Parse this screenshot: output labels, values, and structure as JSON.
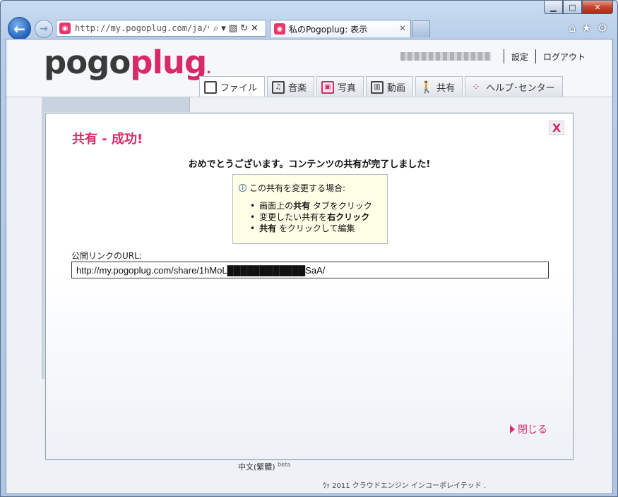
{
  "browser": {
    "address": "http://my.pogoplug.com/ja/view",
    "tab_title": "私のPogoplug: 表示"
  },
  "site": {
    "logo_a": "pogo",
    "logo_b": "plug",
    "settings": "設定",
    "logout": "ログアウト",
    "tabs": [
      {
        "label": "ファイル"
      },
      {
        "label": "音楽"
      },
      {
        "label": "写真"
      },
      {
        "label": "動画"
      },
      {
        "label": "共有"
      },
      {
        "label": "ヘルプ･センター"
      }
    ],
    "footer_lang": "中文(繁體)",
    "footer_beta": "beta",
    "footer_copy": "ｳｯ 2011 クラウドエンジン インコーポレイテッド ."
  },
  "modal": {
    "close_x": "X",
    "title": "共有 - 成功!",
    "message": "おめでとうございます。コンテンツの共有が完了しました!",
    "tip_heading": "この共有を変更する場合:",
    "tips": {
      "t1_a": "画面上の",
      "t1_b": "共有",
      "t1_c": " タブをクリック",
      "t2_a": "変更したい共有を",
      "t2_b": "右クリック",
      "t3_a": "共有",
      "t3_b": " をクリックして編集"
    },
    "url_label": "公開リンクのURL:",
    "url_value": "http://my.pogoplug.com/share/1hMoL████████████SaA/",
    "close_label": "閉じる"
  }
}
